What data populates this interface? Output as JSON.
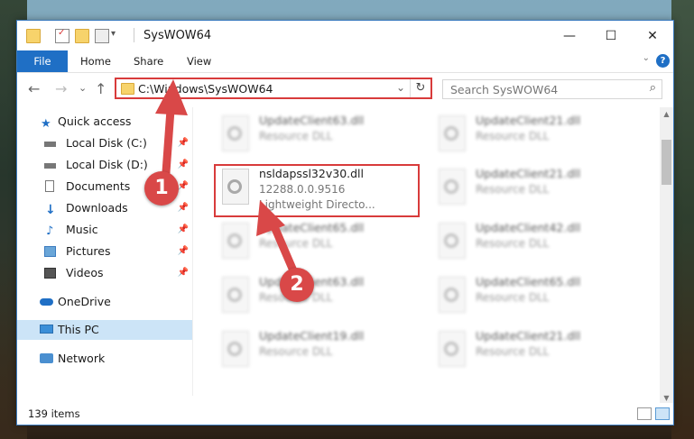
{
  "window": {
    "title": "SysWOW64"
  },
  "titlebar_icons": [
    "folder-icon",
    "properties-icon",
    "new-folder-icon",
    "customize-icon"
  ],
  "controls": {
    "minimize": "—",
    "maximize": "☐",
    "close": "✕"
  },
  "ribbon": {
    "tabs": [
      "File",
      "Home",
      "Share",
      "View"
    ],
    "help": "?"
  },
  "navigation": {
    "back": "←",
    "forward": "→",
    "recent": "⌄",
    "up": "↑"
  },
  "address": {
    "path": "C:\\Windows\\SysWOW64"
  },
  "search": {
    "placeholder": "Search SysWOW64"
  },
  "sidebar": {
    "items": [
      {
        "label": "Quick access",
        "icon": "star-icon"
      },
      {
        "label": "Local Disk (C:)",
        "icon": "drive-icon",
        "pinned": true
      },
      {
        "label": "Local Disk (D:)",
        "icon": "drive-icon",
        "pinned": true
      },
      {
        "label": "Documents",
        "icon": "documents-icon",
        "pinned": true
      },
      {
        "label": "Downloads",
        "icon": "downloads-icon",
        "pinned": true
      },
      {
        "label": "Music",
        "icon": "music-icon",
        "pinned": true
      },
      {
        "label": "Pictures",
        "icon": "pictures-icon",
        "pinned": true
      },
      {
        "label": "Videos",
        "icon": "videos-icon",
        "pinned": true
      },
      {
        "label": "OneDrive",
        "icon": "onedrive-icon"
      },
      {
        "label": "This PC",
        "icon": "pc-icon",
        "selected": true
      },
      {
        "label": "Network",
        "icon": "network-icon"
      }
    ]
  },
  "files": {
    "left": [
      {
        "name": "UpdateClient63.dll",
        "line2": "Resource DLL"
      },
      {
        "name": "nsldapssl32v30.dll",
        "line2": "12288.0.0.9516",
        "line3": "Lightweight Directo..."
      },
      {
        "name": "UpdateClient65.dll",
        "line2": "Resource DLL"
      },
      {
        "name": "UpdateClient63.dll",
        "line2": "Resource DLL"
      },
      {
        "name": "UpdateClient19.dll",
        "line2": "Resource DLL"
      }
    ],
    "right": [
      {
        "name": "UpdateClient21.dll",
        "line2": "Resource DLL"
      },
      {
        "name": "UpdateClient21.dll",
        "line2": "Resource DLL"
      },
      {
        "name": "UpdateClient42.dll",
        "line2": "Resource DLL"
      },
      {
        "name": "UpdateClient65.dll",
        "line2": "Resource DLL"
      },
      {
        "name": "UpdateClient21.dll",
        "line2": "Resource DLL"
      }
    ]
  },
  "status": {
    "items": "139 items"
  },
  "annotations": {
    "step1": "1",
    "step2": "2",
    "color": "#d94848"
  }
}
